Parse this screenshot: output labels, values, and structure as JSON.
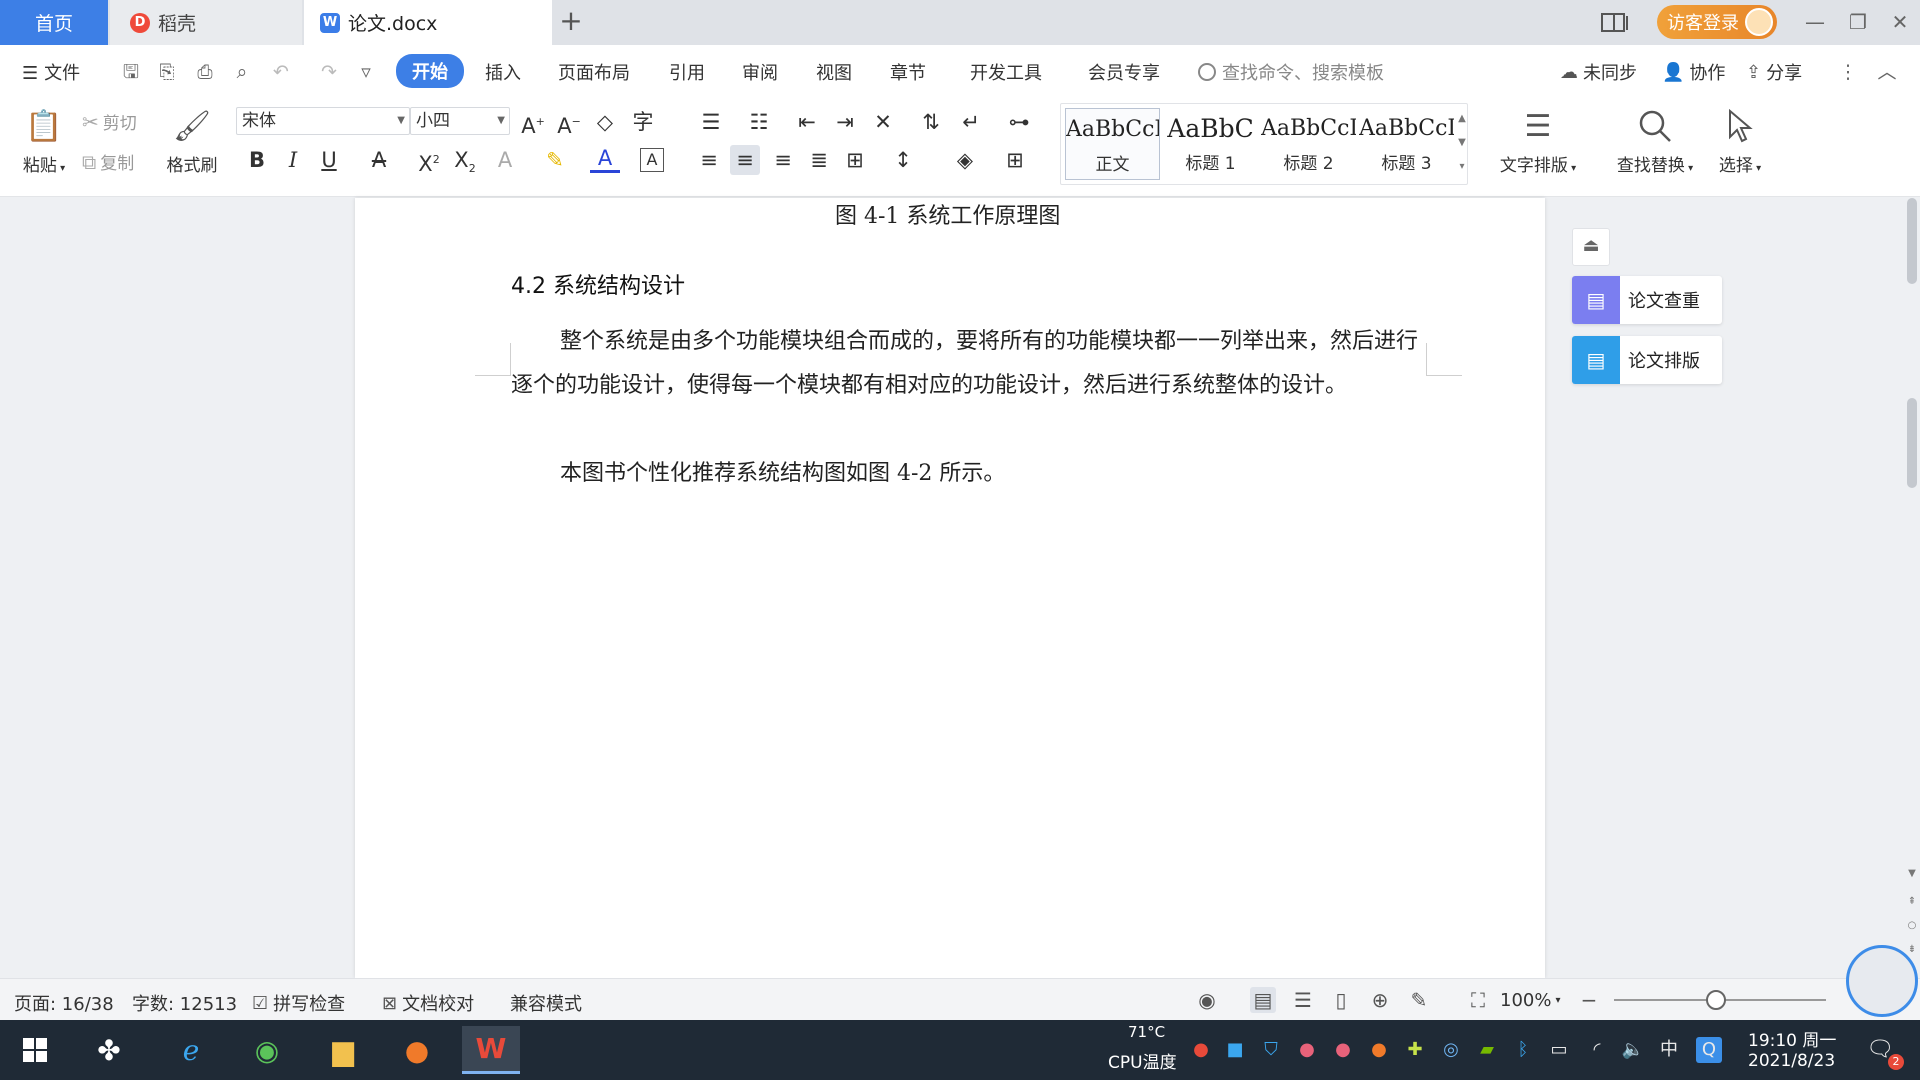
{
  "tabs": {
    "home": "首页",
    "daoke": "稻壳",
    "document": "论文.docx",
    "daoke_logo": "D",
    "doc_logo": "W"
  },
  "titlebar": {
    "visitor_login": "访客登录"
  },
  "menu": {
    "file": "文件",
    "items": [
      "开始",
      "插入",
      "页面布局",
      "引用",
      "审阅",
      "视图",
      "章节",
      "开发工具",
      "会员专享"
    ],
    "search_placeholder": "查找命令、搜索模板",
    "unsynced": "未同步",
    "collaborate": "协作",
    "share": "分享"
  },
  "ribbon": {
    "paste": "粘贴",
    "cut": "剪切",
    "copy": "复制",
    "format_painter": "格式刷",
    "font_name": "宋体",
    "font_size": "小四",
    "styles": [
      {
        "sample": "AaBbCcI",
        "name": "正文"
      },
      {
        "sample": "AaBbC",
        "name": "标题 1"
      },
      {
        "sample": "AaBbCcI",
        "name": "标题 2"
      },
      {
        "sample": "AaBbCcI",
        "name": "标题 3"
      }
    ],
    "text_layout": "文字排版",
    "find_replace": "查找替换",
    "select": "选择"
  },
  "document": {
    "caption": "图 4-1  系统工作原理图",
    "heading": "4.2 系统结构设计",
    "paragraph1": "整个系统是由多个功能模块组合而成的，要将所有的功能模块都一一列举出来，然后进行逐个的功能设计，使得每一个模块都有相对应的功能设计，然后进行系统整体的设计。",
    "paragraph2": "本图书个性化推荐系统结构图如图 4-2 所示。"
  },
  "side_panel": {
    "paper_check": "论文查重",
    "paper_layout": "论文排版"
  },
  "statusbar": {
    "page": "页面: 16/38",
    "word_count": "字数: 12513",
    "spell_check": "拼写检查",
    "doc_proof": "文档校对",
    "compat_mode": "兼容模式",
    "zoom": "100%"
  },
  "taskbar": {
    "cpu_temp": "71°C",
    "cpu_label": "CPU温度",
    "ime": "中",
    "time": "19:10 周一",
    "date": "2021/8/23",
    "notification_count": "2"
  },
  "colors": {
    "accent": "#3d7fe6",
    "visitor_orange": "#e8862a",
    "paper_check_purple": "#7b7ef0",
    "paper_layout_blue": "#2f9ee8",
    "taskbar_bg": "#1f2a36"
  }
}
